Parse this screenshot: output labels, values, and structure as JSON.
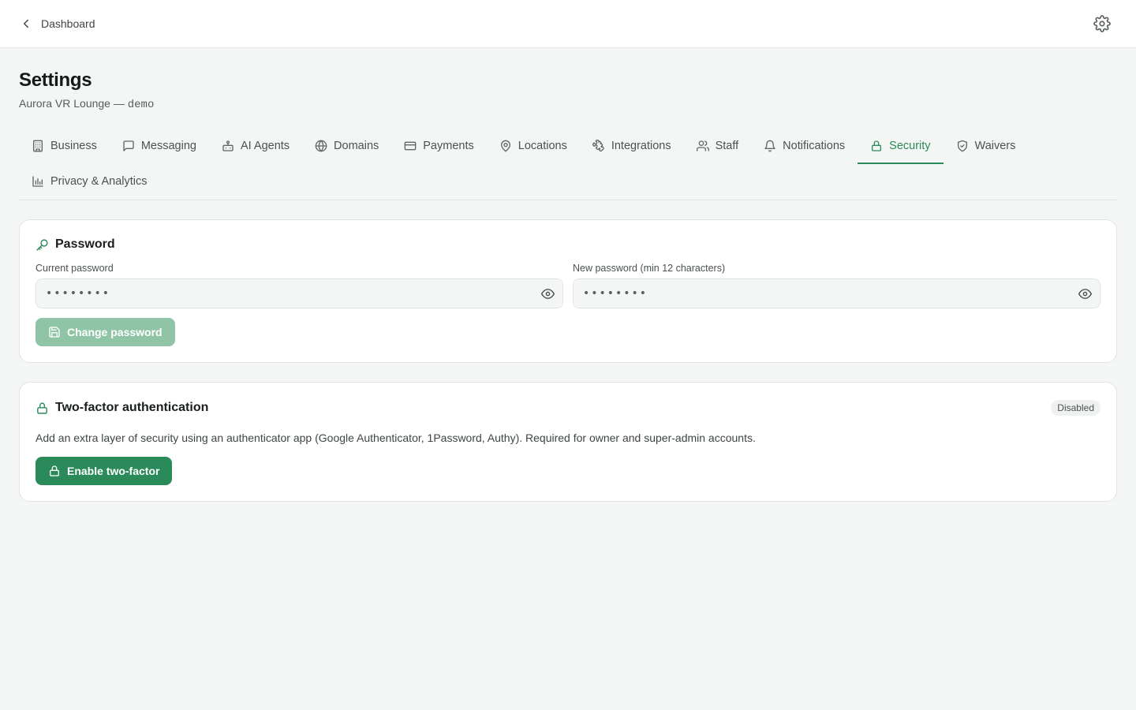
{
  "topbar": {
    "back_label": "Dashboard"
  },
  "header": {
    "title": "Settings",
    "venue": "Aurora VR Lounge —",
    "env": "demo"
  },
  "tabs": [
    {
      "label": "Business",
      "icon": "building-icon"
    },
    {
      "label": "Messaging",
      "icon": "message-icon"
    },
    {
      "label": "AI Agents",
      "icon": "bot-icon"
    },
    {
      "label": "Domains",
      "icon": "globe-icon"
    },
    {
      "label": "Payments",
      "icon": "credit-card-icon"
    },
    {
      "label": "Locations",
      "icon": "map-pin-icon"
    },
    {
      "label": "Integrations",
      "icon": "puzzle-icon"
    },
    {
      "label": "Staff",
      "icon": "users-icon"
    },
    {
      "label": "Notifications",
      "icon": "bell-icon"
    },
    {
      "label": "Security",
      "icon": "lock-icon",
      "active": true
    },
    {
      "label": "Waivers",
      "icon": "shield-check-icon"
    },
    {
      "label": "Privacy & Analytics",
      "icon": "bar-chart-icon"
    }
  ],
  "password": {
    "title": "Password",
    "current_label": "Current password",
    "current_placeholder": "••••••••",
    "new_label": "New password (min 12 characters)",
    "new_placeholder": "••••••••",
    "button_label": "Change password"
  },
  "twofactor": {
    "title": "Two-factor authentication",
    "status": "Disabled",
    "description": "Add an extra layer of security using an authenticator app (Google Authenticator, 1Password, Authy). Required for owner and super-admin accounts.",
    "button_label": "Enable two-factor"
  },
  "colors": {
    "accent": "#2a8a5a",
    "accent_disabled": "#8fc4a6",
    "background": "#f4f6f5"
  }
}
